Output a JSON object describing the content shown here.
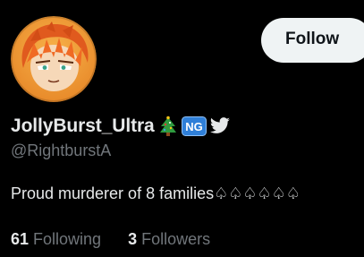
{
  "profile": {
    "display_name": "JollyBurst_Ultra",
    "handle": "@RightburstA",
    "bio": "Proud murderer of 8 families♤♤♤♤♤♤",
    "badges": [
      "christmas-tree-icon",
      "ng-badge-icon",
      "twitter-bird-icon"
    ],
    "ng_badge_text": "NG"
  },
  "actions": {
    "follow_label": "Follow"
  },
  "stats": {
    "following_count": "61",
    "following_label": "Following",
    "followers_count": "3",
    "followers_label": "Followers"
  },
  "colors": {
    "background": "#000000",
    "primary_text": "#e7e9ea",
    "secondary_text": "#71767b",
    "follow_button_bg": "#eff3f4",
    "follow_button_text": "#0f1419",
    "avatar_bg": "#f2a13c",
    "ng_badge_bg": "#2f7fd8",
    "twitter_bird": "#e7e9ea"
  }
}
